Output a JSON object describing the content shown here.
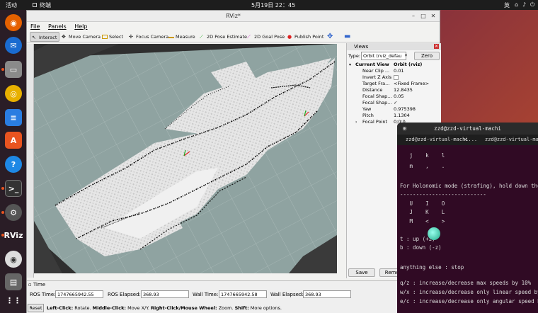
{
  "topbar": {
    "activities": "活动",
    "app": "终端",
    "clock": "5月19日  22：45",
    "lang": "英"
  },
  "window": {
    "title": "RViz*"
  },
  "menu": {
    "file": "File",
    "panels": "Panels",
    "help": "Help"
  },
  "toolbar": [
    {
      "label": "Interact",
      "icon": "interact-icon"
    },
    {
      "label": "Move Camera",
      "icon": "move-camera-icon"
    },
    {
      "label": "Select",
      "icon": "select-icon"
    },
    {
      "label": "Focus Camera",
      "icon": "focus-camera-icon"
    },
    {
      "label": "Measure",
      "icon": "measure-icon"
    },
    {
      "label": "2D Pose Estimate",
      "icon": "pose-estimate-icon"
    },
    {
      "label": "2D Goal Pose",
      "icon": "goal-pose-icon"
    },
    {
      "label": "Publish Point",
      "icon": "publish-point-icon"
    }
  ],
  "views": {
    "header": "Views",
    "type_label": "Type:",
    "type_value": "Orbit (rviz_defau",
    "zero_label": "Zero",
    "current_view": "Current View",
    "current_view_value": "Orbit (rviz)",
    "props": [
      {
        "k": "Near Clip ...",
        "v": "0.01"
      },
      {
        "k": "Invert Z Axis",
        "v": ""
      },
      {
        "k": "Target Fra...",
        "v": "<Fixed Frame>"
      },
      {
        "k": "Distance",
        "v": "12.8435"
      },
      {
        "k": "Focal Shap...",
        "v": "0.05"
      },
      {
        "k": "Focal Shap...",
        "v": "✓"
      },
      {
        "k": "Yaw",
        "v": "0.975398"
      },
      {
        "k": "Pitch",
        "v": "1.1304"
      },
      {
        "k": "Focal Point",
        "v": "0;0;0"
      }
    ],
    "save_label": "Save",
    "remove_label": "Remove"
  },
  "time": {
    "header": "Time",
    "ros_time_label": "ROS Time:",
    "ros_time": "1747665942.55",
    "ros_elapsed_label": "ROS Elapsed:",
    "ros_elapsed": "368.93",
    "wall_time_label": "Wall Time:",
    "wall_time": "1747665942.58",
    "wall_elapsed_label": "Wall Elapsed:",
    "wall_elapsed": "368.93",
    "reset_label": "Reset",
    "help_b1": "Left-Click:",
    "help_t1": " Rotate. ",
    "help_b2": "Middle-Click:",
    "help_t2": " Move X/Y. ",
    "help_b3": "Right-Click/Mouse Wheel:",
    "help_t3": " Zoom. ",
    "help_b4": "Shift:",
    "help_t4": " More options."
  },
  "terminal": {
    "title": "zzd@zzd-virtual-machi",
    "tab1": "zzd@zzd-virtual-machi...",
    "tab2": "zzd@zzd-virtual-machi",
    "lines": [
      "   j    k    l",
      "   m    ,    .",
      "",
      "For Holonomic mode (strafing), hold down the",
      "---------------------------",
      "   U    I    O",
      "   J    K    L",
      "   M    <    >",
      "",
      "t : up (+z)",
      "b : down (-z)",
      "",
      "anything else : stop",
      "",
      "q/z : increase/decrease max speeds by 10%",
      "w/x : increase/decrease only linear speed by",
      "e/c : increase/decrease only angular speed by"
    ]
  }
}
